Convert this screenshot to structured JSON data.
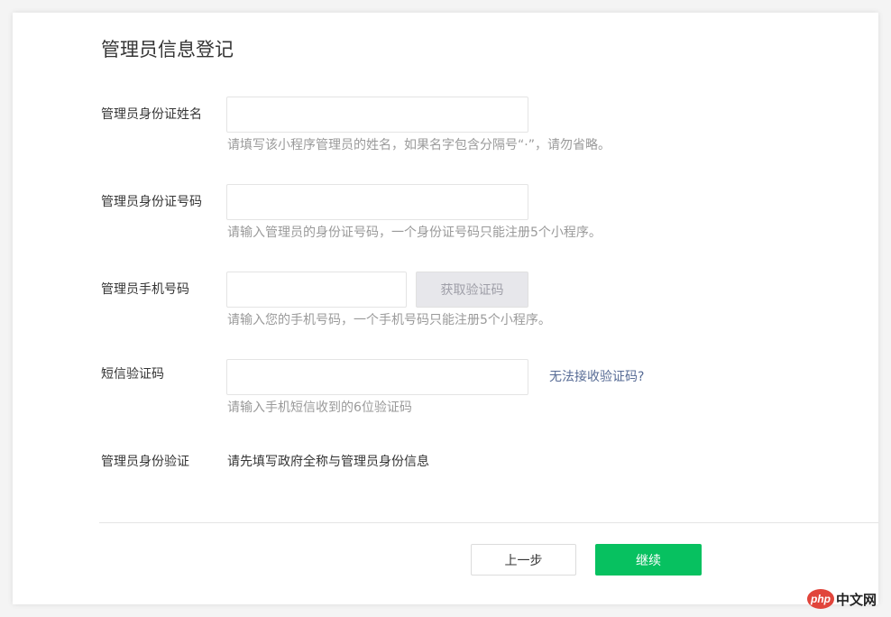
{
  "page": {
    "title": "管理员信息登记"
  },
  "fields": {
    "name": {
      "label": "管理员身份证姓名",
      "value": "",
      "hint": "请填写该小程序管理员的姓名，如果名字包含分隔号“·”，请勿省略。"
    },
    "id_number": {
      "label": "管理员身份证号码",
      "value": "",
      "hint": "请输入管理员的身份证号码，一个身份证号码只能注册5个小程序。"
    },
    "phone": {
      "label": "管理员手机号码",
      "value": "",
      "button": "获取验证码",
      "hint": "请输入您的手机号码，一个手机号码只能注册5个小程序。"
    },
    "sms_code": {
      "label": "短信验证码",
      "value": "",
      "link": "无法接收验证码?",
      "hint": "请输入手机短信收到的6位验证码"
    },
    "identity_verify": {
      "label": "管理员身份验证",
      "value": "请先填写政府全称与管理员身份信息"
    }
  },
  "actions": {
    "back_label": "上一步",
    "next_label": "继续"
  },
  "watermark": {
    "logo_text": "php",
    "site_text": "中文网"
  },
  "colors": {
    "primary_button": "#07c160",
    "link": "#576b95",
    "hint_text": "#9a9a9a",
    "watermark_logo": "#e1453b"
  }
}
